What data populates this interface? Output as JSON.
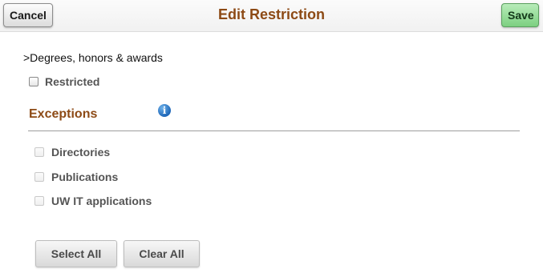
{
  "header": {
    "title": "Edit Restriction",
    "cancel_label": "Cancel",
    "save_label": "Save"
  },
  "breadcrumb": ">Degrees, honors & awards",
  "restricted": {
    "label": "Restricted",
    "checked": false
  },
  "exceptions": {
    "title": "Exceptions",
    "info_icon": "info-icon",
    "items": [
      {
        "label": "Directories",
        "checked": false,
        "disabled": true
      },
      {
        "label": "Publications",
        "checked": false,
        "disabled": true
      },
      {
        "label": "UW IT applications",
        "checked": false,
        "disabled": true
      }
    ]
  },
  "actions": {
    "select_all_label": "Select All",
    "clear_all_label": "Clear All"
  },
  "colors": {
    "title": "#8d4a15",
    "save_button": "#7dd081",
    "info_icon": "#1e67b8"
  }
}
